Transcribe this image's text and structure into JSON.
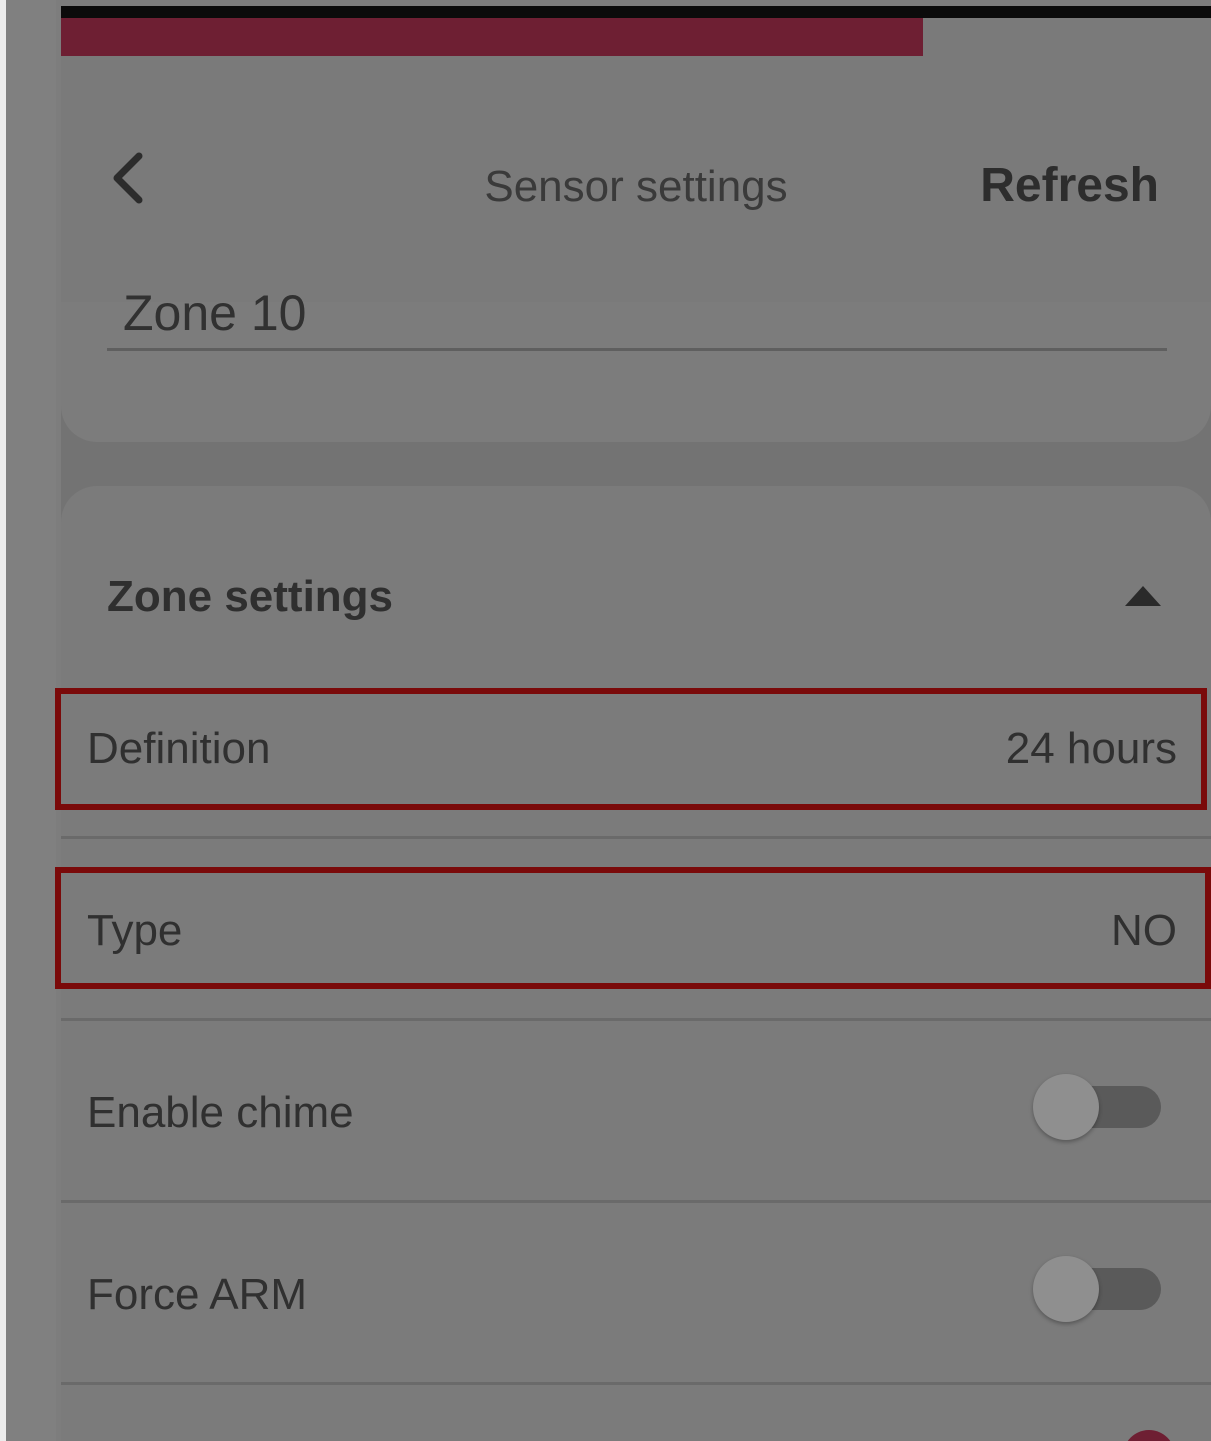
{
  "header": {
    "title": "Sensor settings",
    "refresh_label": "Refresh",
    "back_icon": "chevron-left-icon"
  },
  "zone_name_field": {
    "value": "Zone 10"
  },
  "zone_settings": {
    "title": "Zone settings",
    "collapse_icon": "caret-up-icon",
    "rows": [
      {
        "label": "Definition",
        "value": "24 hours"
      },
      {
        "label": "Type",
        "value": "NO"
      },
      {
        "label": "Enable chime",
        "toggle": false
      },
      {
        "label": "Force ARM",
        "toggle": false
      }
    ]
  },
  "colors": {
    "accent": "#6e1f33",
    "highlight_border": "#7a0a0a",
    "overlay": "#737373"
  }
}
